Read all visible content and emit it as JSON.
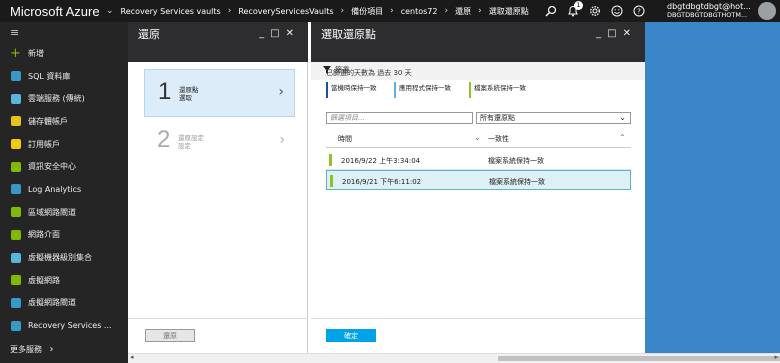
{
  "topbar": {
    "brand": "Microsoft Azure",
    "breadcrumbs": [
      "Recovery Services vaults",
      "RecoveryServicesVaults",
      "備份項目",
      "centos72",
      "還原",
      "選取還原點"
    ],
    "notification_count": "1",
    "user_name": "dbgtdbgtdbgt@hot...",
    "user_tenant": "DBGTDBGTDBGTHOTM..."
  },
  "sidebar": {
    "menu_icon": "hamburger-icon",
    "items": [
      {
        "label": "新增",
        "icon": "plus-icon",
        "color": "#7fba00"
      },
      {
        "label": "SQL 資料庫",
        "icon": "sql-database-icon",
        "color": "#3999c6"
      },
      {
        "label": "雲端服務 (傳統)",
        "icon": "cloud-icon",
        "color": "#59b4d9"
      },
      {
        "label": "儲存體帳戶",
        "icon": "storage-icon",
        "color": "#e8c11a"
      },
      {
        "label": "訂用帳戶",
        "icon": "key-icon",
        "color": "#f2c811"
      },
      {
        "label": "資訊安全中心",
        "icon": "shield-icon",
        "color": "#7fba00"
      },
      {
        "label": "Log Analytics",
        "icon": "log-analytics-icon",
        "color": "#3999c6"
      },
      {
        "label": "區域網路閘道",
        "icon": "gateway-icon",
        "color": "#7fba00"
      },
      {
        "label": "網路介面",
        "icon": "nic-icon",
        "color": "#7fba00"
      },
      {
        "label": "虛擬機器級別集合",
        "icon": "vmss-icon",
        "color": "#59b4d9"
      },
      {
        "label": "虛擬網路",
        "icon": "vnet-icon",
        "color": "#7fba00"
      },
      {
        "label": "虛擬網路閘道",
        "icon": "lock-icon",
        "color": "#3999c6"
      },
      {
        "label": "Recovery Services ...",
        "icon": "recovery-vault-icon",
        "color": "#3999c6"
      }
    ],
    "more_services": "更多服務",
    "more_chevron": "›"
  },
  "restore_blade": {
    "title": "還原",
    "steps": [
      {
        "number": "1",
        "title": "還原點",
        "subtitle": "選取"
      },
      {
        "number": "2",
        "title": "還原設定",
        "subtitle": "設定"
      }
    ],
    "restore_button": "還原"
  },
  "select_blade": {
    "title": "選取還原點",
    "filter_label": "篩選",
    "info": "已篩選的天數為 過去 30 天",
    "legend": [
      {
        "label": "當機時保持一致",
        "color": "#1f4e9e"
      },
      {
        "label": "應用程式保持一致",
        "color": "#5db3d9"
      },
      {
        "label": "檔案系統保持一致",
        "color": "#95c11f"
      }
    ],
    "search_placeholder": "篩選項目...",
    "select_value": "所有還原點",
    "columns": [
      "時間",
      "一致性"
    ],
    "rows": [
      {
        "time": "2016/9/22 上午3:34:04",
        "consistency": "檔案系統保持一致",
        "selected": false
      },
      {
        "time": "2016/9/21 下午6:11:02",
        "consistency": "檔案系統保持一致",
        "selected": true
      }
    ],
    "confirm_button": "確定"
  },
  "window_controls": {
    "minimize": "_",
    "maximize": "□",
    "close": "✕"
  }
}
